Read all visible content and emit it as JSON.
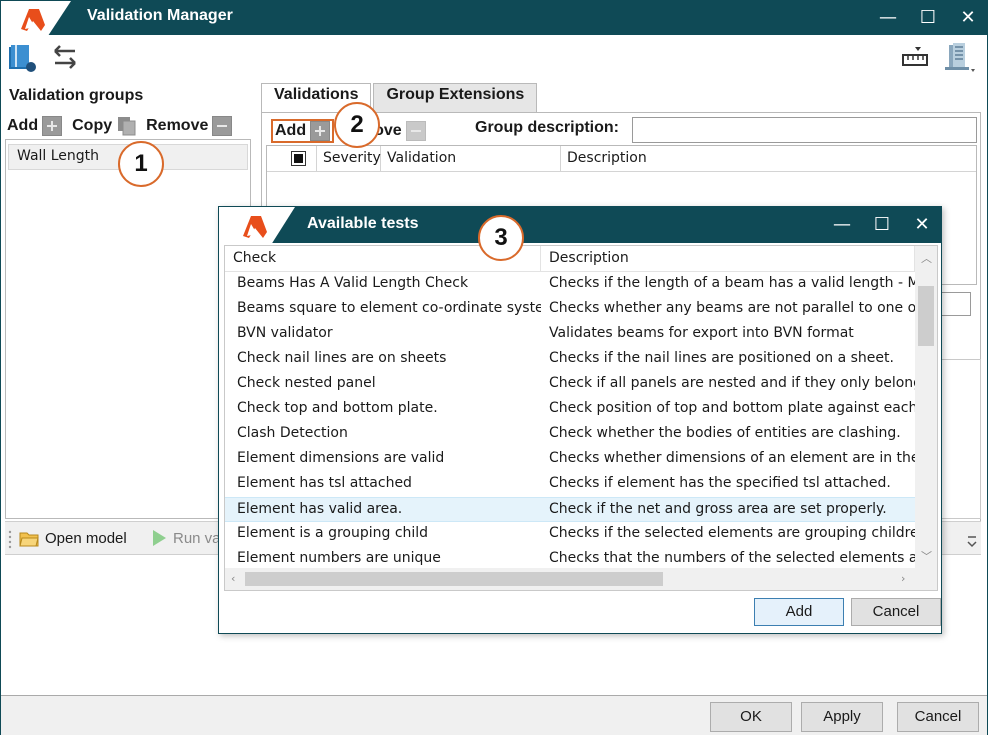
{
  "window": {
    "title": "Validation Manager",
    "controls": {
      "minimize": "—",
      "maximize": "☐",
      "close": "✕"
    }
  },
  "left_panel": {
    "header": "Validation groups",
    "add_label": "Add",
    "copy_label": "Copy",
    "remove_label": "Remove",
    "items": [
      "Wall Length"
    ]
  },
  "tabs": [
    {
      "label": "Validations",
      "active": true
    },
    {
      "label": "Group Extensions",
      "active": false
    }
  ],
  "validations_tab": {
    "add_label": "Add",
    "remove_label_partial": "ove",
    "group_description_label": "Group description:",
    "group_description_value": "",
    "columns": [
      "Severity",
      "Validation",
      "Description"
    ]
  },
  "under_bar": {
    "open_model": "Open model",
    "run_partial": "Run va"
  },
  "footer": {
    "ok": "OK",
    "apply": "Apply",
    "cancel": "Cancel"
  },
  "callouts": [
    "1",
    "2",
    "3"
  ],
  "dialog": {
    "title": "Available tests",
    "controls": {
      "minimize": "—",
      "maximize": "☐",
      "close": "✕"
    },
    "columns": [
      "Check",
      "Description"
    ],
    "rows": [
      {
        "check": "Beams Has A Valid Length Check",
        "description": "Checks if the length of a beam has a valid length - Mi"
      },
      {
        "check": "Beams square to element co-ordinate syste",
        "description": "Checks whether any beams are not parallel to one of"
      },
      {
        "check": "BVN validator",
        "description": "Validates beams for export into BVN format"
      },
      {
        "check": "Check nail lines are on sheets",
        "description": "Checks if the nail lines are positioned on a sheet."
      },
      {
        "check": "Check nested panel",
        "description": "Check if all panels are nested and if they only belong"
      },
      {
        "check": "Check top and bottom plate.",
        "description": "Check position of top and bottom plate against eacho"
      },
      {
        "check": "Clash Detection",
        "description": "Check whether the bodies of entities are clashing."
      },
      {
        "check": "Element dimensions are valid",
        "description": "Checks whether dimensions of an element are in the s"
      },
      {
        "check": "Element has tsl attached",
        "description": "Checks if element has the specified tsl attached."
      },
      {
        "check": "Element has valid area.",
        "description": "Check if the net and gross area are set properly."
      },
      {
        "check": "Element is a grouping child",
        "description": "Checks if the selected elements are grouping children"
      },
      {
        "check": "Element numbers are unique",
        "description": "Checks that the numbers of the selected elements are"
      }
    ],
    "add_button": "Add",
    "cancel_button": "Cancel"
  },
  "colors": {
    "titlebar": "#0f4a56",
    "accent_orange": "#d96a2b",
    "selection": "#e5f3fb"
  }
}
